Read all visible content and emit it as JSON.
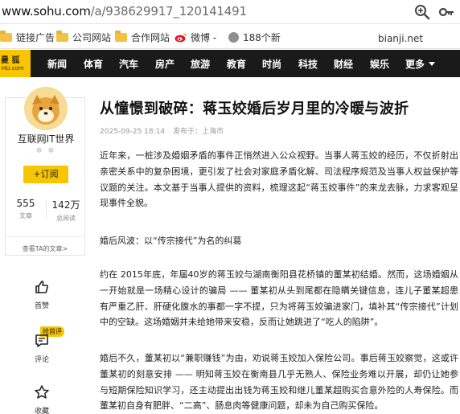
{
  "address_bar": {
    "url_host": "www.sohu.com",
    "url_path": "/a/938629917_120141491",
    "icons": [
      "zoom-icon",
      "key-icon"
    ]
  },
  "bookmarks": {
    "items": [
      {
        "label": "链接广告",
        "icon": "folder-icon"
      },
      {
        "label": "公司网站",
        "icon": "folder-icon"
      },
      {
        "label": "合作网站",
        "icon": "folder-icon"
      },
      {
        "label": "微博 -",
        "icon": "weibo-icon"
      },
      {
        "label": "188个新",
        "icon": "globe-icon"
      }
    ],
    "watermark": "bianji.net"
  },
  "nav": {
    "logo_line1": "曼 狐",
    "logo_line2": "HU.com",
    "items": [
      "新闻",
      "体育",
      "汽车",
      "房产",
      "旅游",
      "教育",
      "时尚",
      "科技",
      "财经",
      "娱乐"
    ],
    "more_label": "更多"
  },
  "author": {
    "name": "互联网IT世界",
    "medals": "☸ ☸",
    "follow_label": "+订阅",
    "stats": [
      {
        "value": "555",
        "label": "文章"
      },
      {
        "value": "142万",
        "label": "总阅读"
      }
    ],
    "see_articles_label": "查看TA的文章>"
  },
  "actions": {
    "like_label": "首赞",
    "comment_label": "评论",
    "hot_tag": "抢首评",
    "collect_label": "收藏"
  },
  "article": {
    "title": "从憧憬到破碎：蒋玉姣婚后岁月里的冷暖与波折",
    "date": "2025-09-25 18:14",
    "source_prefix": "发布于：",
    "source_location": "上海市",
    "p1": "近年来，一桩涉及婚姻矛盾的事件正悄然进入公众视野。当事人蒋玉姣的经历，不仅折射出亲密关系中的复杂困境，更引发了社会对家庭矛盾化解、司法程序规范及当事人权益保护等议题的关注。本文基于当事人提供的资料，梳理这起“蒋玉姣事件”的来龙去脉，力求客观呈现事件全貌。",
    "heading1": "婚后风波：以“传宗接代”为名的纠葛",
    "p2": "约在 2015年底，年届40岁的蒋玉姣与湖南衡阳县花桥镇的董某初结婚。然而，这场婚姻从一开始就是一场精心设计的骗局 —— 董某初从头到尾都在隐瞒关键信息，连儿子董某超患有严重乙肝、肝硬化腹水的事都一字不提，只为将蒋玉姣骗进家门，填补其“传宗接代”计划中的空缺。这场婚姻并未给她带来安稳，反而让她跳进了“吃人的陷阱”。",
    "p3": "婚后不久，董某初以“兼职赚钱”为由，劝说蒋玉姣加入保险公司。事后蒋玉姣察觉，这或许董某初的刻意安排 —— 明知蒋玉姣在衡南县几乎无熟人、保险业务难以开展，却仍让她参与短期保险知识学习，还主动提出出钱为蒋玉姣和继儿董某超购买合意外险的人寿保险。而董某初自身有肥胖、“二高”、肠息肉等健康问题，却未为自己购买保险。"
  }
}
